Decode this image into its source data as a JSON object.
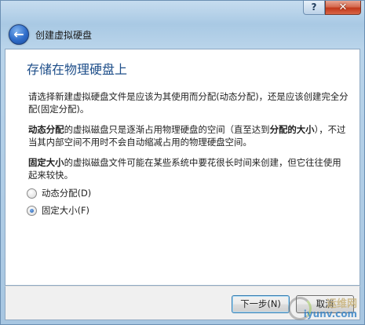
{
  "window": {
    "help_label": "?",
    "close_label": "✕",
    "wizard_title": "创建虚拟硬盘"
  },
  "icons": {
    "back": "back-arrow-icon",
    "help": "help-icon",
    "close": "close-icon"
  },
  "content": {
    "heading": "存储在物理硬盘上",
    "para1": "请选择新建虚拟硬盘文件是应该为其使用而分配(动态分配)，还是应该创建完全分配(固定分配)。",
    "para2_bold_start": "动态分配",
    "para2_mid": "的虚拟磁盘只是逐渐占用物理硬盘的空间（直至达到",
    "para2_bold_mid": "分配的大小",
    "para2_end": "），不过当其内部空间不用时不会自动缩减占用的物理硬盘空间。",
    "para3_bold_start": "固定大小",
    "para3_rest": "的虚拟磁盘文件可能在某些系统中要花很长时间来创建，但它往往使用起来较快。",
    "options": [
      {
        "label": "动态分配(D)",
        "checked": false
      },
      {
        "label": "固定大小(F)",
        "checked": true
      }
    ]
  },
  "footer": {
    "next_label": "下一步(N)",
    "cancel_label": "取消"
  },
  "watermark": {
    "top": "运维网",
    "bottom": "iyunv.com"
  },
  "colors": {
    "heading": "#1f4f8a",
    "frame": "#a9c9e4",
    "close_button": "#c2381a"
  }
}
